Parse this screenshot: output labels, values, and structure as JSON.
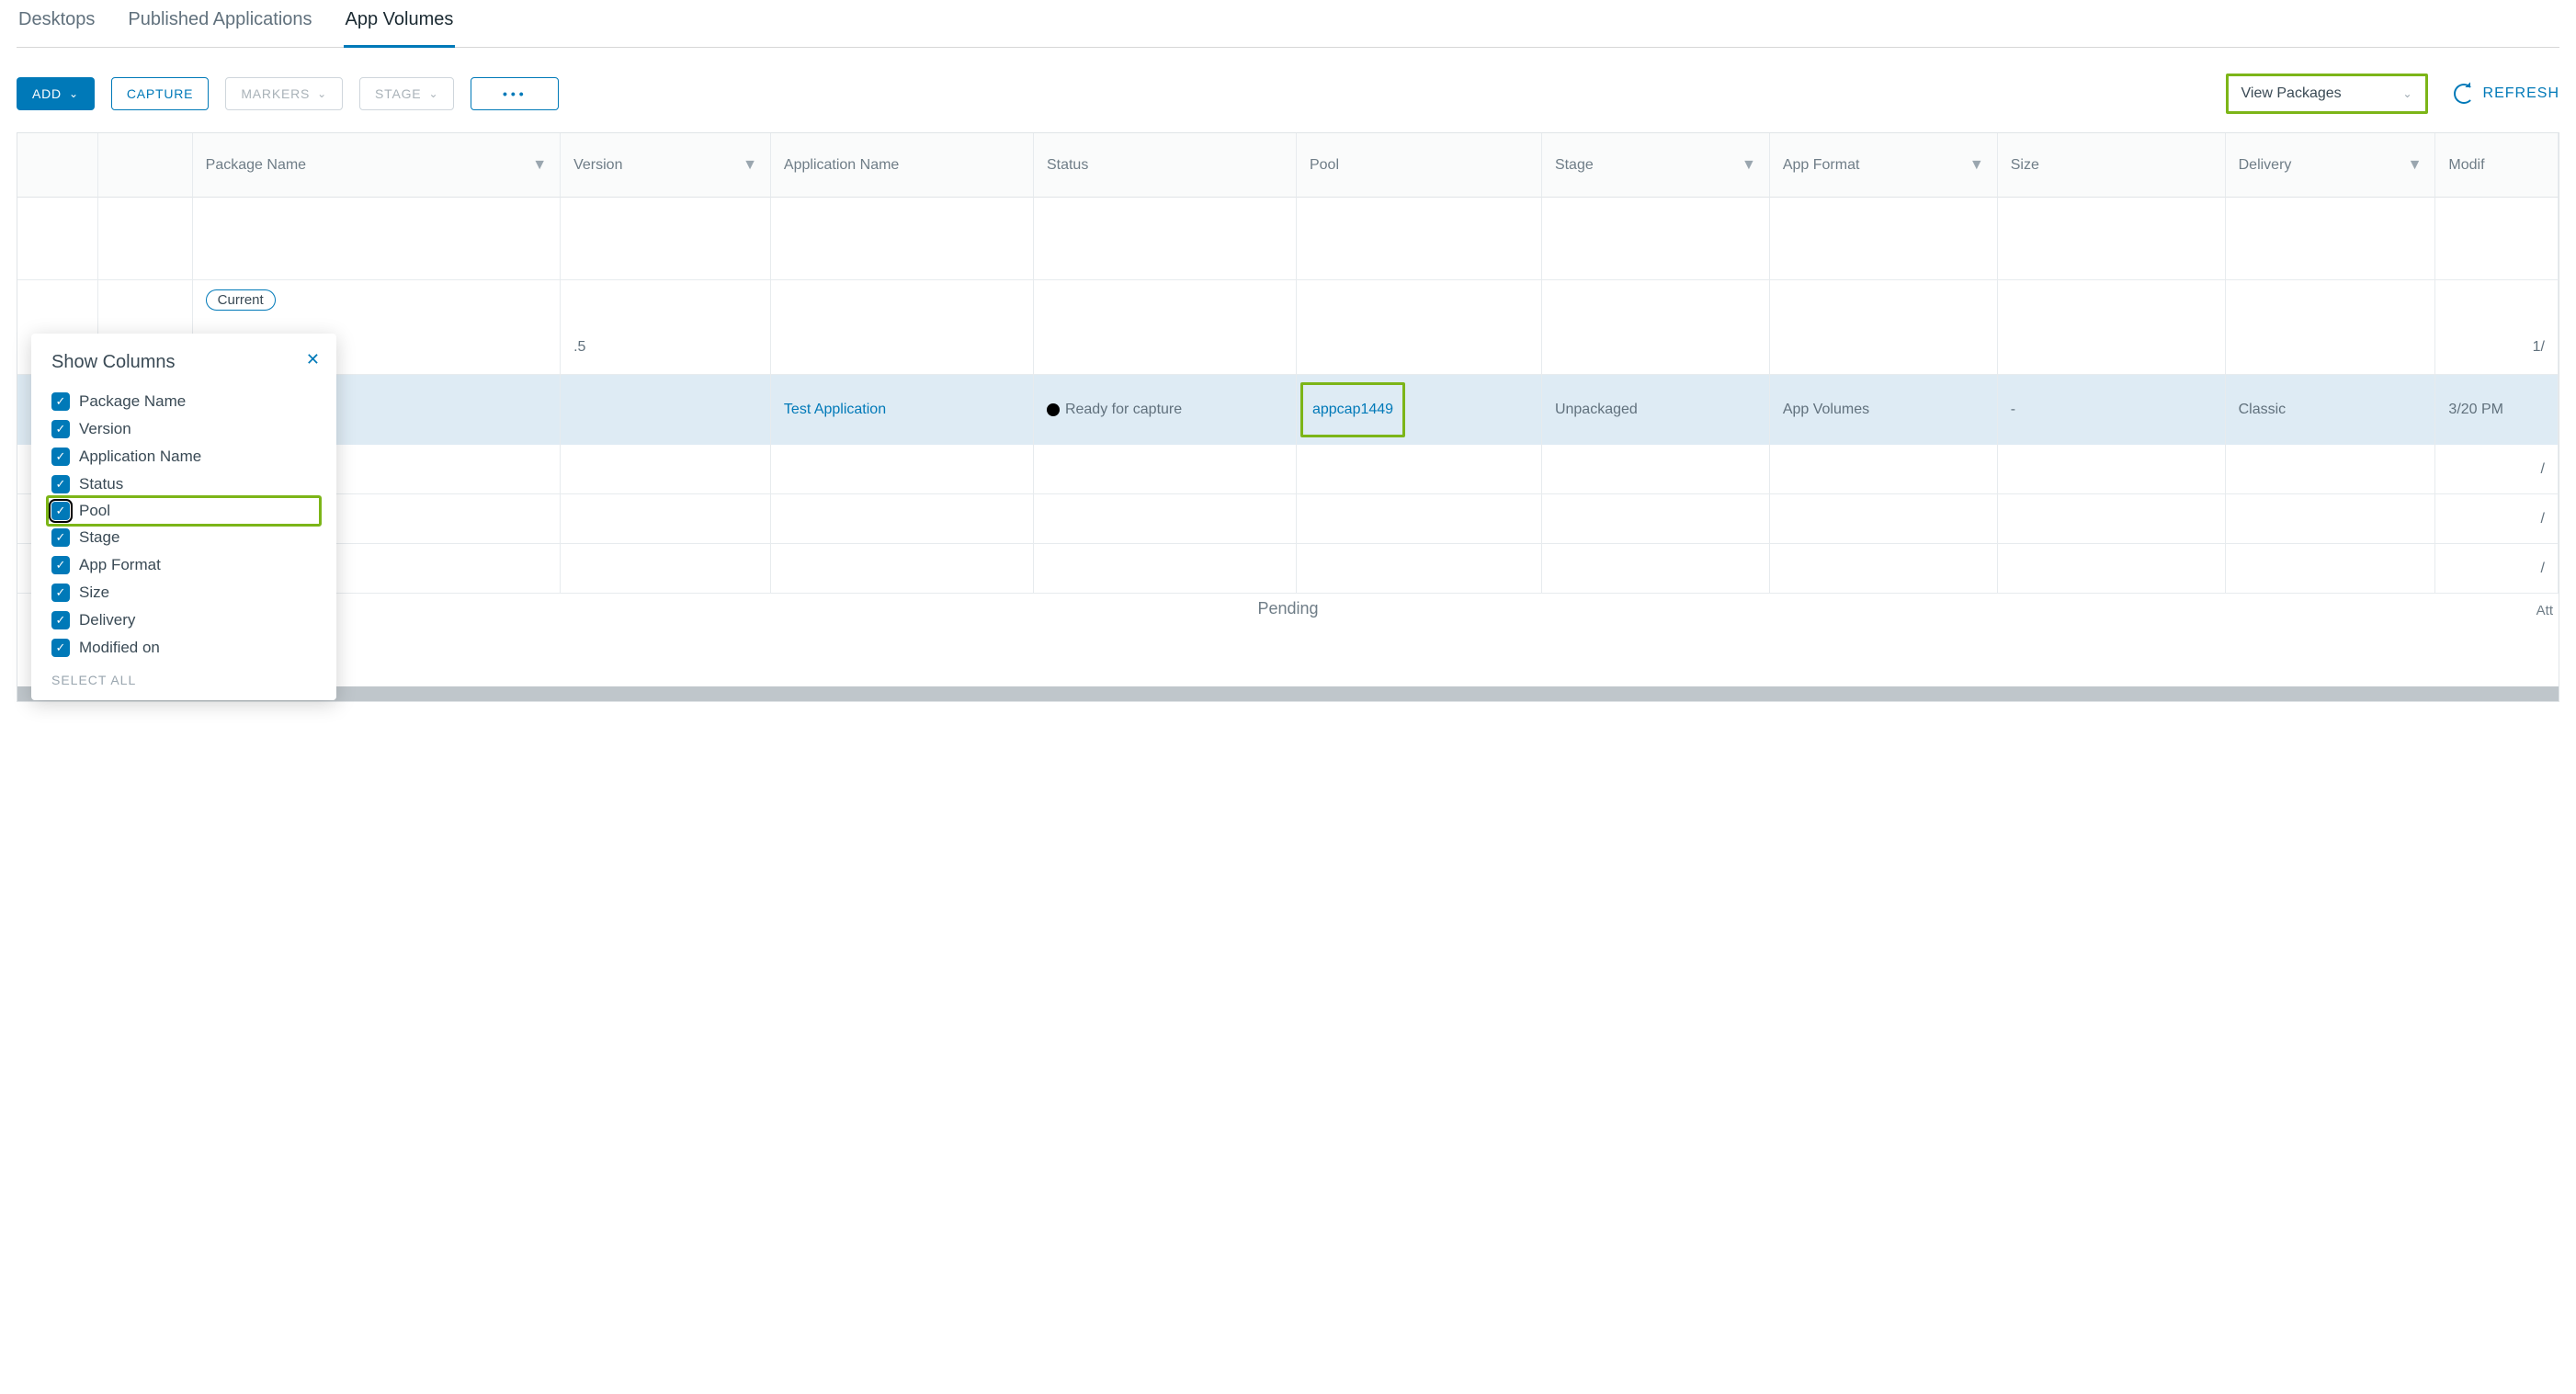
{
  "tabs": {
    "desktops": "Desktops",
    "published": "Published Applications",
    "appvol": "App Volumes"
  },
  "toolbar": {
    "add": "ADD",
    "capture": "CAPTURE",
    "markers": "MARKERS",
    "stage": "STAGE",
    "view_select": "View Packages",
    "refresh": "REFRESH"
  },
  "columns": {
    "package_name": "Package Name",
    "version": "Version",
    "app_name": "Application Name",
    "status": "Status",
    "pool": "Pool",
    "stage": "Stage",
    "app_format": "App Format",
    "size": "Size",
    "delivery": "Delivery",
    "modified": "Modif"
  },
  "marker_label": "Current",
  "visible_version": ".5",
  "row": {
    "app_name": "Test Application",
    "status": "Ready for capture",
    "pool": "appcap1449",
    "stage": "Unpackaged",
    "app_format": "App Volumes",
    "size": "-",
    "delivery": "Classic",
    "modified": "3/20 PM"
  },
  "partial_dates": {
    "a": "1/",
    "b": "/",
    "c": "/",
    "d": "/"
  },
  "pending": "Pending",
  "right_partial": "Att",
  "popup": {
    "title": "Show Columns",
    "items": {
      "pn": "Package Name",
      "ver": "Version",
      "an": "Application Name",
      "st": "Status",
      "pool": "Pool",
      "stage": "Stage",
      "af": "App Format",
      "size": "Size",
      "del": "Delivery",
      "mod": "Modified on"
    },
    "select_all": "SELECT ALL"
  }
}
